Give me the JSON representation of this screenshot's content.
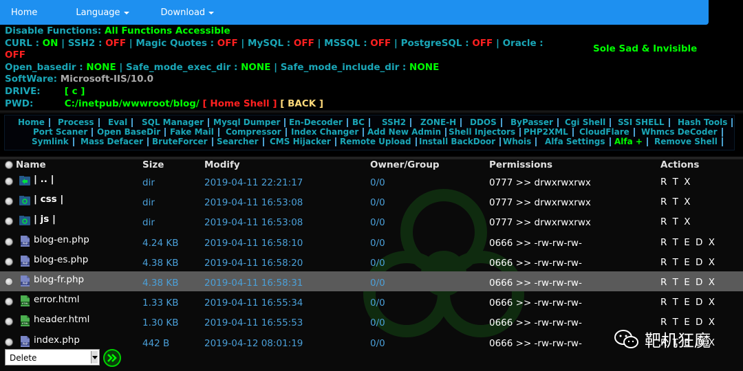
{
  "nav": {
    "home": "Home",
    "language": "Language",
    "download": "Download"
  },
  "info": {
    "disable_label": "Disable Functions:",
    "disable_value": "All Functions Accessible",
    "curl_label": "CURL :",
    "curl_value": "ON",
    "ssh2_label": "SSH2 :",
    "ssh2_value": "OFF",
    "magic_label": "Magic Quotes :",
    "magic_value": "OFF",
    "mysql_label": "MySQL :",
    "mysql_value": "OFF",
    "mssql_label": "MSSQL :",
    "mssql_value": "OFF",
    "pg_label": "PostgreSQL :",
    "pg_value": "OFF",
    "oracle_label": "Oracle :",
    "oracle_value": "OFF",
    "openbd_label": "Open_basedir :",
    "openbd_value": "NONE",
    "safeexec_label": "Safe_mode_exec_dir :",
    "safeexec_value": "NONE",
    "safeinc_label": "Safe_mode_include_dir :",
    "safeinc_value": "NONE",
    "software_label": "SoftWare:",
    "software_value": "Microsoft-IIS/10.0",
    "drive_label": "DRIVE:",
    "drive_value": "[ c ]",
    "pwd_label": "PWD:",
    "pwd_value": "C:/inetpub/wwwroot/blog/",
    "home_shell": "[ Home Shell ]",
    "back": "[ BACK ]",
    "tagline": "Sole Sad & Invisible"
  },
  "menu": {
    "row1": [
      "Home",
      "Process",
      "Eval",
      "SQL Manager",
      "Mysql Dumper",
      "En-Decoder",
      "BC",
      "SSH2",
      "ZONE-H",
      "DDOS",
      "ByPasser",
      "Cgi Shell",
      "SSI SHELL",
      "Hash Tools"
    ],
    "row2": [
      "Port Scaner",
      "Open BaseDir",
      "Fake Mail",
      "Compressor",
      "Index Changer",
      "Add New Admin",
      "Shell Injectors",
      "PHP2XML",
      "CloudFlare",
      "Whmcs DeCoder"
    ],
    "row3": [
      "Symlink",
      "Mass Defacer",
      "BruteForcer",
      "Searcher",
      "CMS Hijacker",
      "Remote Upload",
      "Install BackDoor",
      "Whois",
      "Alfa Settings",
      "Alfa +",
      "Remove Shell"
    ]
  },
  "table": {
    "headers": {
      "name": "Name",
      "size": "Size",
      "modify": "Modify",
      "owner": "Owner/Group",
      "perms": "Permissions",
      "actions": "Actions"
    },
    "rows": [
      {
        "name": "| .. |",
        "size": "dir",
        "modify": "2019-04-11 22:21:17",
        "owner": "0/0",
        "perms": "0777 >> drwxrwxrwx",
        "actions": "R T X",
        "icon": "folder-up-icon"
      },
      {
        "name": "| css |",
        "size": "dir",
        "modify": "2019-04-11 16:53:08",
        "owner": "0/0",
        "perms": "0777 >> drwxrwxrwx",
        "actions": "R T X",
        "icon": "folder-icon"
      },
      {
        "name": "| js |",
        "size": "dir",
        "modify": "2019-04-11 16:53:08",
        "owner": "0/0",
        "perms": "0777 >> drwxrwxrwx",
        "actions": "R T X",
        "icon": "folder-icon"
      },
      {
        "name": "blog-en.php",
        "size": "4.24 KB",
        "modify": "2019-04-11 16:58:10",
        "owner": "0/0",
        "perms": "0666 >> -rw-rw-rw-",
        "actions": "R T E D X",
        "icon": "php-file-icon"
      },
      {
        "name": "blog-es.php",
        "size": "4.38 KB",
        "modify": "2019-04-11 16:58:20",
        "owner": "0/0",
        "perms": "0666 >> -rw-rw-rw-",
        "actions": "R T E D X",
        "icon": "php-file-icon"
      },
      {
        "name": "blog-fr.php",
        "size": "4.38 KB",
        "modify": "2019-04-11 16:58:31",
        "owner": "0/0",
        "perms": "0666 >> -rw-rw-rw-",
        "actions": "R T E D X",
        "icon": "php-file-icon"
      },
      {
        "name": "error.html",
        "size": "1.33 KB",
        "modify": "2019-04-11 16:55:34",
        "owner": "0/0",
        "perms": "0666 >> -rw-rw-rw-",
        "actions": "R T E D X",
        "icon": "html-file-icon"
      },
      {
        "name": "header.html",
        "size": "1.30 KB",
        "modify": "2019-04-11 16:55:53",
        "owner": "0/0",
        "perms": "0666 >> -rw-rw-rw-",
        "actions": "R T E D X",
        "icon": "html-file-icon"
      },
      {
        "name": "index.php",
        "size": "442 B",
        "modify": "2019-04-12 08:01:19",
        "owner": "0/0",
        "perms": "0666 >> -rw-rw-rw-",
        "actions": "R T E D X",
        "icon": "php-file-icon"
      }
    ]
  },
  "bottom": {
    "select_value": "Delete",
    "watermark": "靶机狂魔"
  }
}
